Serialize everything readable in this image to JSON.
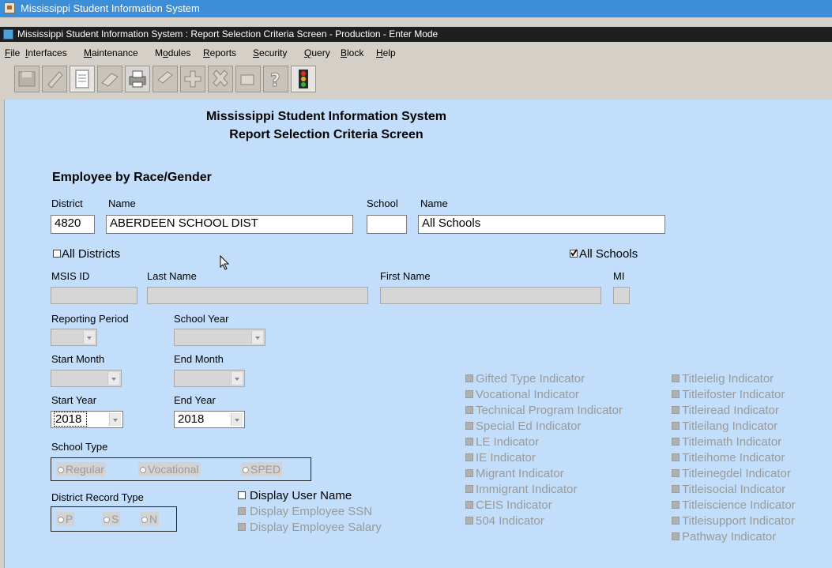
{
  "window": {
    "os_title": "Mississippi Student Information System",
    "inner_title": "Mississippi Student Information System : Report Selection Criteria Screen  -  Production  -  Enter Mode"
  },
  "menu": {
    "file": "ile",
    "file_u": "F",
    "interfaces_u": "I",
    "interfaces": "nterfaces",
    "maintenance_u": "M",
    "maintenance": "aintenance",
    "modules_pre": "M",
    "modules_u": "o",
    "modules": "dules",
    "reports_u": "R",
    "reports": "eports",
    "security_u": "S",
    "security": "ecurity",
    "query_u": "Q",
    "query": "uery",
    "block_u": "B",
    "block": "lock",
    "help_u": "H",
    "help": "elp"
  },
  "toolbar": [
    "save-icon",
    "edit-icon",
    "document-icon",
    "eraser-icon",
    "print-icon",
    "search-icon",
    "add-icon",
    "delete-icon",
    "clear-icon",
    "help-icon",
    "traffic-light-icon"
  ],
  "header": {
    "line1": "Mississippi Student Information System",
    "line2": "Report Selection Criteria Screen"
  },
  "report_title": "Employee by Race/Gender",
  "labels": {
    "district": "District",
    "name": "Name",
    "school": "School",
    "name2": "Name",
    "all_districts": "All Districts",
    "all_schools": "All Schools",
    "msis_id": "MSIS ID",
    "last_name": "Last Name",
    "first_name": "First Name",
    "mi": "MI",
    "reporting_period": "Reporting Period",
    "school_year": "School Year",
    "start_month": "Start Month",
    "end_month": "End Month",
    "start_year": "Start Year",
    "end_year": "End Year",
    "school_type": "School Type",
    "district_record_type": "District Record Type"
  },
  "values": {
    "district": "4820",
    "district_name": "ABERDEEN SCHOOL DIST",
    "school": "",
    "school_name": "All Schools",
    "start_year": "2018",
    "end_year": "2018"
  },
  "school_type_options": [
    "Regular",
    "Vocational",
    "SPED"
  ],
  "record_type_options": [
    "P",
    "S",
    "N"
  ],
  "display_options": [
    "Display User Name",
    "Display Employee SSN",
    "Display Employee Salary"
  ],
  "indicators_col1": [
    "Gifted Type Indicator",
    "Vocational Indicator",
    "Technical Program Indicator",
    "Special Ed Indicator",
    "LE Indicator",
    "IE Indicator",
    "Migrant Indicator",
    "Immigrant Indicator",
    "CEIS Indicator",
    "504 Indicator"
  ],
  "indicators_col2": [
    "Titleielig Indicator",
    "Titleifoster Indicator",
    "Titleiread Indicator",
    "Titleilang Indicator",
    "Titleimath Indicator",
    "Titleihome Indicator",
    "Titleinegdel Indicator",
    "Titleisocial Indicator",
    "Titleiscience Indicator",
    "Titleisupport Indicator",
    "Pathway Indicator"
  ],
  "colors": {
    "titlebar": "#3c8ed8",
    "inner_titlebar": "#1f1f1f",
    "panel": "#c2defa"
  }
}
